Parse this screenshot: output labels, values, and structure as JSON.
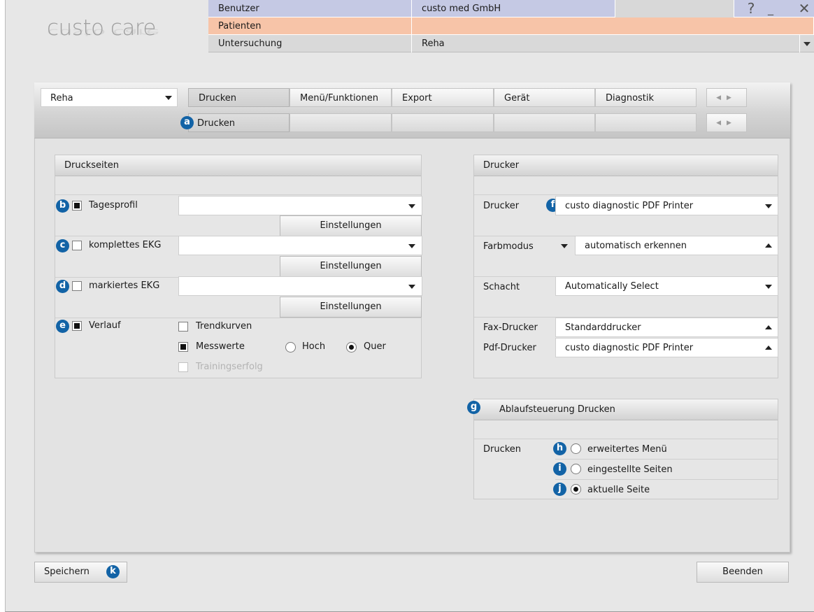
{
  "logo": {
    "text": "custo care"
  },
  "header": {
    "rows": [
      {
        "label": "Benutzer",
        "value": "custo med GmbH"
      },
      {
        "label": "Patienten",
        "value": ""
      },
      {
        "label": "Untersuchung",
        "value": "Reha"
      }
    ],
    "help_label": "?",
    "minimize_label": "_",
    "close_label": "✕"
  },
  "toolbar": {
    "module_select": "Reha",
    "tabs": [
      "Drucken",
      "Menü/Funktionen",
      "Export",
      "Gerät",
      "Diagnostik"
    ],
    "active_tab": "Drucken",
    "subtabs": [
      "Drucken"
    ]
  },
  "druckseiten": {
    "title": "Druckseiten",
    "settings_label": "Einstellungen",
    "items": [
      {
        "label": "Tagesprofil",
        "checked": true,
        "value": ""
      },
      {
        "label": "komplettes EKG",
        "checked": false,
        "value": ""
      },
      {
        "label": "markiertes EKG",
        "checked": false,
        "value": ""
      }
    ],
    "verlauf": {
      "label": "Verlauf",
      "checked": true,
      "trendkurven": "Trendkurven",
      "messwerte": "Messwerte",
      "hoch": "Hoch",
      "quer": "Quer",
      "trainingserfolg": "Trainingserfolg"
    }
  },
  "drucker": {
    "title": "Drucker",
    "drucker_label": "Drucker",
    "drucker_value": "custo diagnostic PDF Printer",
    "farbmodus_label": "Farbmodus",
    "farbmodus_value": "automatisch erkennen",
    "schacht_label": "Schacht",
    "schacht_value": "Automatically Select",
    "fax_label": "Fax-Drucker",
    "fax_value": "Standarddrucker",
    "pdf_label": "Pdf-Drucker",
    "pdf_value": "custo diagnostic PDF Printer"
  },
  "ablauf": {
    "title": "Ablaufsteuerung Drucken",
    "drucken_label": "Drucken",
    "options": [
      "erweitertes Menü",
      "eingestellte Seiten",
      "aktuelle Seite"
    ],
    "selected": "aktuelle Seite"
  },
  "badges": [
    "a",
    "b",
    "c",
    "d",
    "e",
    "f",
    "g",
    "h",
    "i",
    "j",
    "k"
  ],
  "footer": {
    "save_label": "Speichern",
    "exit_label": "Beenden"
  },
  "colors": {
    "benutzer_row": "#c5c9e4",
    "patienten_row": "#f7c4a8",
    "untersuchung_row": "#d9d9d9",
    "badge": "#1263a6"
  }
}
